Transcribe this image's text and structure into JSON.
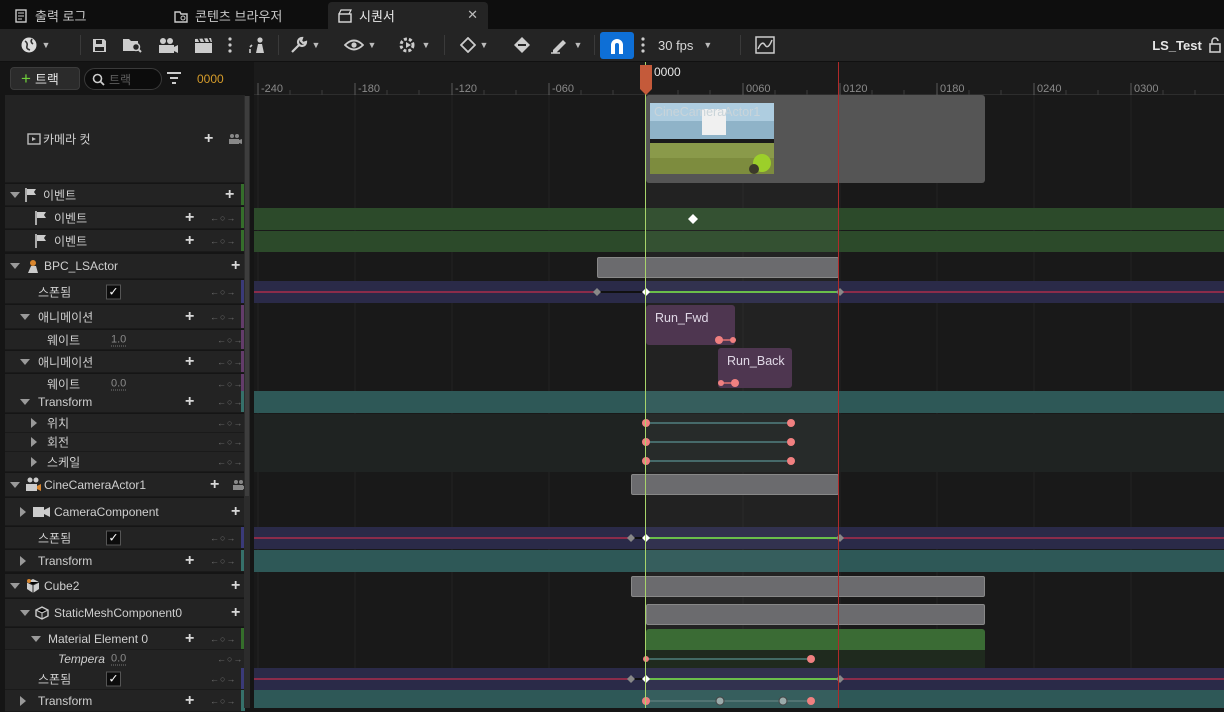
{
  "tabs": [
    {
      "label": "출력 로그",
      "icon": "output-log-icon",
      "active": false
    },
    {
      "label": "콘텐츠 브라우저",
      "icon": "content-browser-icon",
      "active": false
    },
    {
      "label": "시퀀서",
      "icon": "sequencer-icon",
      "active": true
    }
  ],
  "toolbar": {
    "fps": "30 fps",
    "sequence_name": "LS_Test",
    "snap_enabled": true,
    "accent": "#0e6fd6"
  },
  "tree_header": {
    "add_track_label": "트랙",
    "search_placeholder": "트랙",
    "current_time": "0000"
  },
  "tracks": [
    {
      "label": "카메라 컷",
      "icon": "camera-cut-icon"
    },
    {
      "label": "이벤트",
      "icon": "flag-icon"
    },
    {
      "label": "이벤트",
      "icon": "flag-icon"
    },
    {
      "label": "이벤트",
      "icon": "flag-icon"
    },
    {
      "label": "BPC_LSActor",
      "icon": "actor-icon"
    },
    {
      "label": "스폰됨",
      "checked": true
    },
    {
      "label": "애니메이션"
    },
    {
      "label": "웨이트",
      "value": "1.0"
    },
    {
      "label": "애니메이션"
    },
    {
      "label": "웨이트",
      "value": "0.0"
    },
    {
      "label": "Transform"
    },
    {
      "label": "위치"
    },
    {
      "label": "회전"
    },
    {
      "label": "스케일"
    },
    {
      "label": "CineCameraActor1",
      "icon": "cine-camera-icon"
    },
    {
      "label": "CameraComponent",
      "icon": "camera-component-icon"
    },
    {
      "label": "스폰됨",
      "checked": true
    },
    {
      "label": "Transform"
    },
    {
      "label": "Cube2",
      "icon": "cube-actor-icon"
    },
    {
      "label": "StaticMeshComponent0",
      "icon": "static-mesh-icon"
    },
    {
      "label": "Material Element 0"
    },
    {
      "label": "Tempera",
      "value": "0.0"
    },
    {
      "label": "스폰됨",
      "checked": true
    },
    {
      "label": "Transform"
    }
  ],
  "ruler": {
    "playhead_label": "0000",
    "ticks": [
      "-240",
      "-180",
      "-120",
      "-060",
      "0060",
      "0120",
      "0180",
      "0240",
      "0300"
    ]
  },
  "clips": {
    "camera_shot": "CineCameraActor1",
    "anim1": "Run_Fwd",
    "anim2": "Run_Back"
  }
}
